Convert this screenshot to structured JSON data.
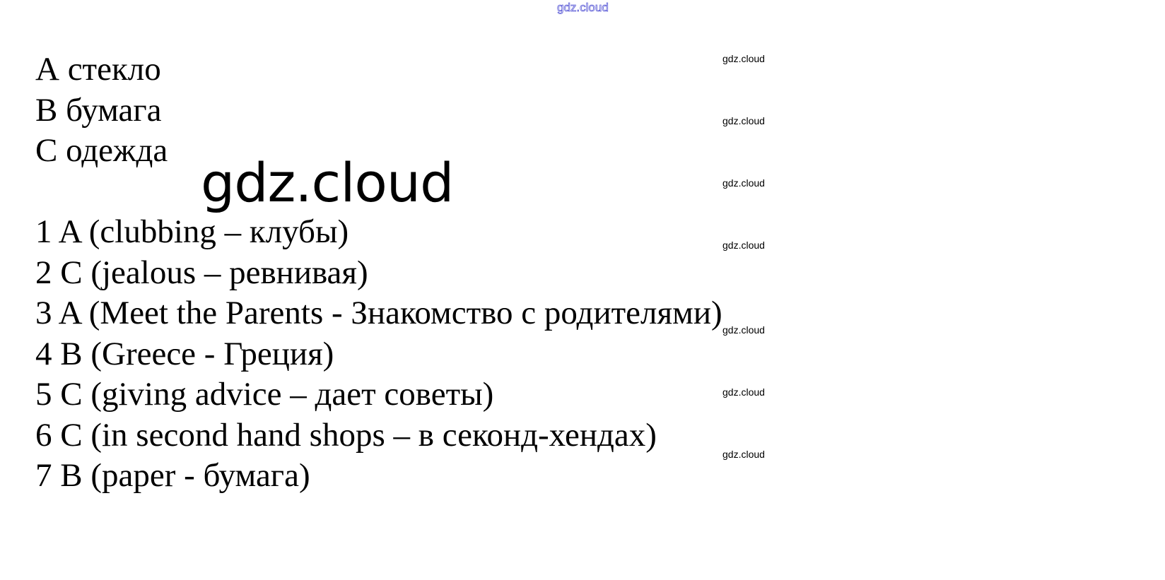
{
  "header_watermark": "gdz.cloud",
  "big_watermark": "gdz.cloud",
  "side_watermarks": [
    "gdz.cloud",
    "gdz.cloud",
    "gdz.cloud",
    "gdz.cloud",
    "gdz.cloud",
    "gdz.cloud",
    "gdz.cloud"
  ],
  "answers_letters": [
    "А стекло",
    "В бумага",
    "С одежда"
  ],
  "answers_numbered": [
    "1 A (clubbing – клубы)",
    "2 C (jealous – ревнивая)",
    "3 A (Meet the Parents - Знакомство с родителями)",
    "4 B (Greece - Греция)",
    "5 C (giving advice – дает советы)",
    "6 C (in second hand shops – в секонд-хендах)",
    "7 B (paper - бумага)"
  ]
}
